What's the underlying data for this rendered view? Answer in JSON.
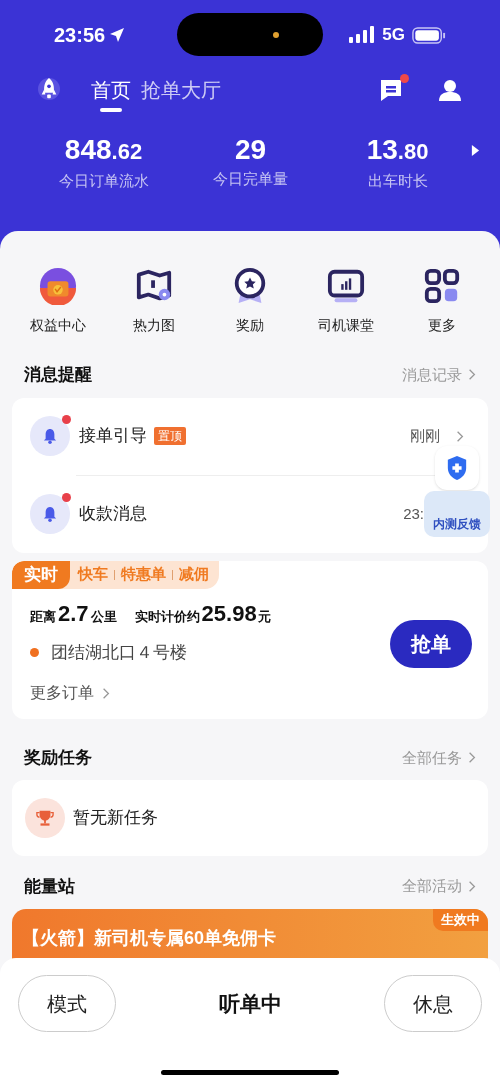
{
  "status_bar": {
    "time": "23:56",
    "network": "5G"
  },
  "nav": {
    "tabs": [
      {
        "label": "首页",
        "selected": true
      },
      {
        "label": "抢单大厅",
        "selected": false
      }
    ],
    "messages_unread": true
  },
  "stats": [
    {
      "value_main": "848",
      "value_fraction": ".62",
      "label": "今日订单流水"
    },
    {
      "value_main": "29",
      "label": "今日完单量"
    },
    {
      "value_main": "13",
      "value_fraction": ".80",
      "label": "出车时长"
    }
  ],
  "shortcuts": [
    {
      "kind": "gift",
      "label": "权益中心"
    },
    {
      "kind": "map",
      "label": "热力图"
    },
    {
      "kind": "medal",
      "label": "奖励"
    },
    {
      "kind": "monitor",
      "label": "司机课堂"
    },
    {
      "kind": "grid",
      "label": "更多"
    }
  ],
  "messages": {
    "title": "消息提醒",
    "link": "消息记录",
    "items": [
      {
        "title": "接单引导",
        "badge": "置顶",
        "time": "刚刚",
        "unread": true
      },
      {
        "title": "收款消息",
        "time": "23:",
        "unread": true
      }
    ]
  },
  "feedback_widget": {
    "label": "内测反馈"
  },
  "order": {
    "tags": [
      {
        "label": "实时",
        "selected": true
      },
      {
        "label": "快车",
        "selected": false
      },
      {
        "label": "特惠单",
        "selected": false
      },
      {
        "label": "减佣",
        "selected": false
      }
    ],
    "distance_label": "距离",
    "distance": "2.7",
    "distance_unit": "公里",
    "price_label": "实时计价约",
    "price": "25.98",
    "price_unit": "元",
    "address": "团结湖北口４号楼",
    "grab_button": "抢单",
    "more_link": "更多订单"
  },
  "tasks": {
    "title": "奖励任务",
    "link": "全部任务",
    "empty_text": "暂无新任务"
  },
  "energy": {
    "title": "能量站",
    "link": "全部活动",
    "banner": {
      "title": "【火箭】新司机专属60单免佣卡",
      "badge": "生效中"
    }
  },
  "bottom_bar": {
    "left_button": "模式",
    "status": "听单中",
    "right_button": "休息"
  }
}
